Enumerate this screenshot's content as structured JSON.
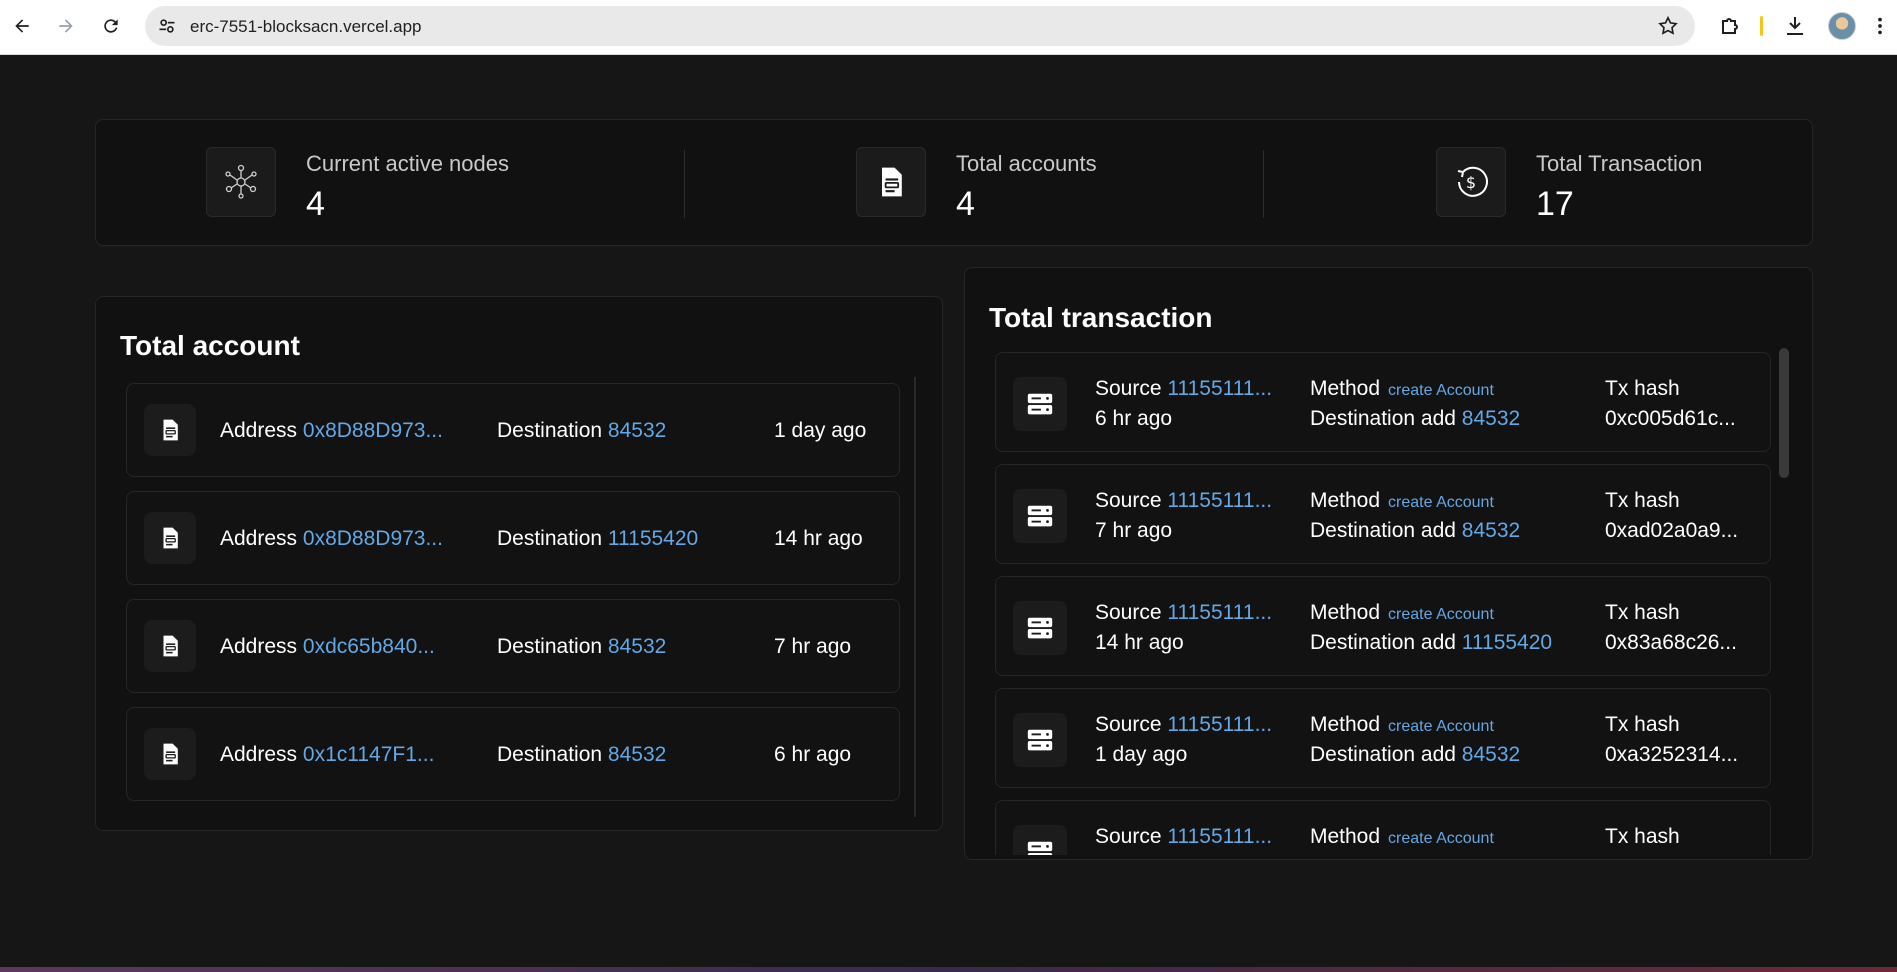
{
  "browser": {
    "url": "erc-7551-blocksacn.vercel.app"
  },
  "stats": [
    {
      "label": "Current active nodes",
      "value": "4",
      "icon": "network-nodes-icon"
    },
    {
      "label": "Total accounts",
      "value": "4",
      "icon": "document-icon"
    },
    {
      "label": "Total Transaction",
      "value": "17",
      "icon": "dollar-refresh-icon"
    }
  ],
  "accounts": {
    "title": "Total account",
    "address_label": "Address",
    "destination_label": "Destination",
    "rows": [
      {
        "address": "0x8D88D973...",
        "destination": "84532",
        "time": "1 day ago"
      },
      {
        "address": "0x8D88D973...",
        "destination": "11155420",
        "time": "14 hr ago"
      },
      {
        "address": "0xdc65b840...",
        "destination": "84532",
        "time": "7 hr ago"
      },
      {
        "address": "0x1c1147F1...",
        "destination": "84532",
        "time": "6 hr ago"
      }
    ]
  },
  "transactions": {
    "title": "Total transaction",
    "source_label": "Source",
    "method_label": "Method",
    "dest_label": "Destination add",
    "hash_label": "Tx hash",
    "rows": [
      {
        "source": "11155111...",
        "time": "6 hr ago",
        "method": "create Account",
        "destination": "84532",
        "hash": "0xc005d61c..."
      },
      {
        "source": "11155111...",
        "time": "7 hr ago",
        "method": "create Account",
        "destination": "84532",
        "hash": "0xad02a0a9..."
      },
      {
        "source": "11155111...",
        "time": "14 hr ago",
        "method": "create Account",
        "destination": "11155420",
        "hash": "0x83a68c26..."
      },
      {
        "source": "11155111...",
        "time": "1 day ago",
        "method": "create Account",
        "destination": "84532",
        "hash": "0xa3252314..."
      },
      {
        "source": "11155111...",
        "time": "",
        "method": "create Account",
        "destination": "",
        "hash": ""
      }
    ]
  },
  "colors": {
    "background": "#161616",
    "card": "#111111",
    "link": "#62a8e5"
  }
}
